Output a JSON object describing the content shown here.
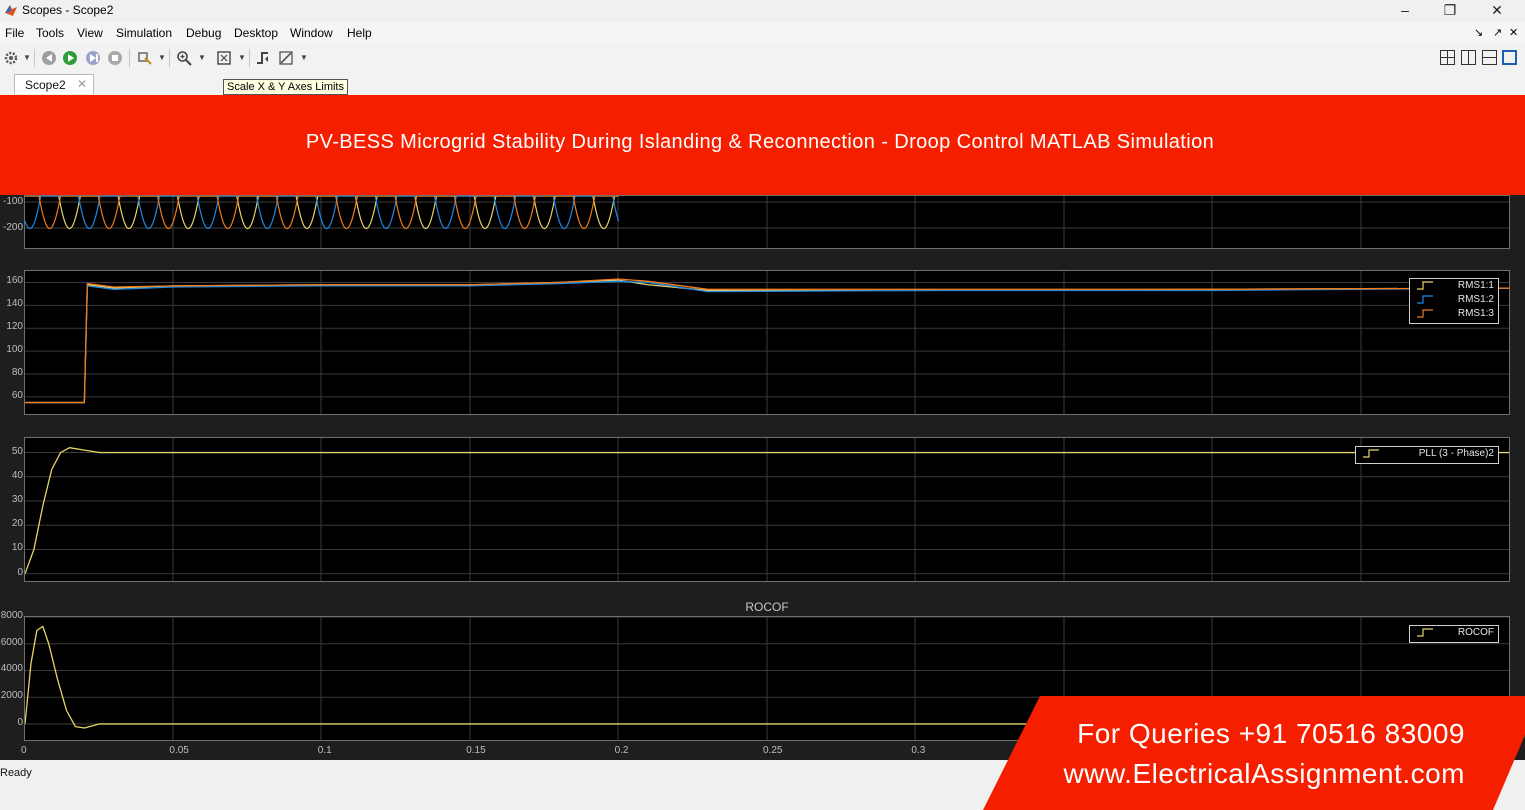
{
  "window": {
    "title": "Scopes - Scope2",
    "minimize": "–",
    "restore": "❐",
    "close": "✕"
  },
  "menu": {
    "items": [
      "File",
      "Tools",
      "View",
      "Simulation",
      "Debug",
      "Desktop",
      "Window",
      "Help"
    ],
    "right": [
      "↘",
      "↗",
      "✕"
    ]
  },
  "toolbar": {
    "icons": [
      "gear-icon",
      "step-back-icon",
      "run-icon",
      "step-forward-icon",
      "stop-icon",
      "highlight-icon",
      "zoom-icon",
      "scale-axes-icon",
      "trigger-icon",
      "measurement-icon"
    ],
    "layouts": [
      "layout-2x2-icon",
      "layout-cols-icon",
      "layout-rows-icon",
      "layout-single-icon"
    ]
  },
  "tab": {
    "label": "Scope2",
    "close": "✕"
  },
  "tooltip": "Scale X & Y Axes Limits",
  "banner": {
    "text": "PV-BESS Microgrid Stability During Islanding & Reconnection - Droop Control MATLAB Simulation",
    "color": "#f51f00"
  },
  "colors": {
    "yellow": "#e6d469",
    "blue": "#1e88e5",
    "orange": "#f07a1a",
    "grid": "#3b3b3b",
    "axes_bg": "#000000"
  },
  "chart_data": [
    {
      "type": "line",
      "title": "",
      "y_ticks": [
        "-100",
        "-200"
      ],
      "xlim": [
        0,
        0.5
      ],
      "grid": true,
      "series": [
        {
          "color": "yellow",
          "frequency_hz": 50,
          "amplitude": 170,
          "phase_deg": 0
        },
        {
          "color": "blue",
          "frequency_hz": 50,
          "amplitude": 170,
          "phase_deg": -120
        },
        {
          "color": "orange",
          "frequency_hz": 50,
          "amplitude": 170,
          "phase_deg": 120
        }
      ],
      "data_end_x": 0.2
    },
    {
      "type": "line",
      "title": "",
      "y_ticks": [
        "160",
        "140",
        "120",
        "100",
        "80",
        "60"
      ],
      "ylim": [
        45,
        170
      ],
      "xlim": [
        0,
        0.5
      ],
      "grid": true,
      "legend_position": "top-right",
      "series": [
        {
          "name": "RMS1:1",
          "color": "yellow",
          "x": [
            0,
            0.02,
            0.021,
            0.03,
            0.05,
            0.1,
            0.15,
            0.18,
            0.2,
            0.21,
            0.23,
            0.3,
            0.4,
            0.5
          ],
          "y": [
            55,
            55,
            158,
            155,
            157,
            158,
            158,
            160,
            162,
            158,
            153,
            153,
            154,
            155
          ]
        },
        {
          "name": "RMS1:2",
          "color": "blue",
          "x": [
            0,
            0.02,
            0.021,
            0.03,
            0.05,
            0.1,
            0.15,
            0.18,
            0.2,
            0.21,
            0.23,
            0.3,
            0.4,
            0.5
          ],
          "y": [
            55,
            55,
            157,
            154,
            156,
            157,
            157,
            159,
            161,
            160,
            152,
            153,
            153,
            155
          ]
        },
        {
          "name": "RMS1:3",
          "color": "orange",
          "x": [
            0,
            0.02,
            0.021,
            0.03,
            0.05,
            0.1,
            0.15,
            0.18,
            0.2,
            0.21,
            0.23,
            0.3,
            0.4,
            0.5
          ],
          "y": [
            55,
            55,
            159,
            156,
            157,
            158,
            158,
            160,
            163,
            161,
            154,
            154,
            154,
            155
          ]
        }
      ]
    },
    {
      "type": "line",
      "title": "",
      "y_ticks": [
        "50",
        "40",
        "30",
        "20",
        "10",
        "0"
      ],
      "ylim": [
        -3,
        56
      ],
      "xlim": [
        0,
        0.5
      ],
      "grid": true,
      "legend_position": "top-right",
      "series": [
        {
          "name": "PLL (3 - Phase)2",
          "color": "yellow",
          "x": [
            0,
            0.003,
            0.006,
            0.009,
            0.012,
            0.015,
            0.02,
            0.025,
            0.03,
            0.5
          ],
          "y": [
            0,
            10,
            28,
            43,
            50,
            52,
            51,
            50,
            50,
            50
          ]
        }
      ]
    },
    {
      "type": "line",
      "title": "ROCOF",
      "y_ticks": [
        "8000",
        "6000",
        "4000",
        "2000",
        "0"
      ],
      "ylim": [
        -1200,
        8000
      ],
      "xlim": [
        0,
        0.5
      ],
      "x_ticks": [
        "0",
        "0.05",
        "0.1",
        "0.15",
        "0.2",
        "0.25",
        "0.3"
      ],
      "grid": true,
      "legend_position": "top-right",
      "series": [
        {
          "name": "ROCOF",
          "color": "yellow",
          "x": [
            0,
            0.002,
            0.004,
            0.006,
            0.008,
            0.011,
            0.014,
            0.017,
            0.02,
            0.025,
            0.03,
            0.5
          ],
          "y": [
            0,
            4500,
            7000,
            7300,
            6000,
            3300,
            1000,
            -200,
            -300,
            0,
            0,
            0
          ]
        }
      ]
    }
  ],
  "status": "Ready",
  "contact": {
    "phone": "For Queries +91 70516 83009",
    "website": "www.ElectricalAssignment.com"
  }
}
